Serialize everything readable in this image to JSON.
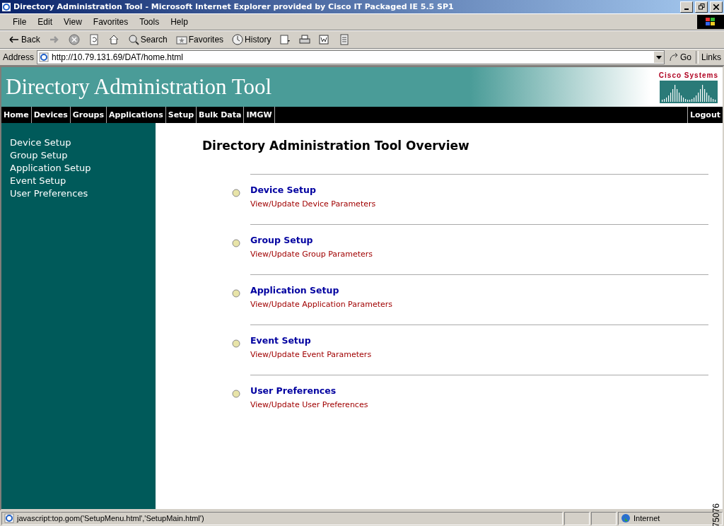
{
  "window": {
    "title": "Directory Administration Tool - Microsoft Internet Explorer provided by Cisco IT Packaged IE 5.5 SP1"
  },
  "menu": [
    "File",
    "Edit",
    "View",
    "Favorites",
    "Tools",
    "Help"
  ],
  "toolbar": [
    {
      "kind": "back",
      "label": "Back"
    },
    {
      "kind": "forward"
    },
    {
      "kind": "stop"
    },
    {
      "kind": "refresh"
    },
    {
      "kind": "home"
    },
    {
      "kind": "search",
      "label": "Search"
    },
    {
      "kind": "favorites",
      "label": "Favorites"
    },
    {
      "kind": "history",
      "label": "History"
    },
    {
      "kind": "mail"
    },
    {
      "kind": "print"
    },
    {
      "kind": "edit"
    },
    {
      "kind": "discuss"
    }
  ],
  "address": {
    "label": "Address",
    "value": "http://10.79.131.69/DAT/home.html",
    "go": "Go",
    "links": "Links"
  },
  "header": {
    "title": "Directory Administration Tool",
    "logo": "Cisco Systems"
  },
  "nav": [
    {
      "label": "Home"
    },
    {
      "label": "Devices"
    },
    {
      "label": "Groups"
    },
    {
      "label": "Applications"
    },
    {
      "label": "Setup"
    },
    {
      "label": "Bulk Data"
    },
    {
      "label": "IMGW"
    }
  ],
  "logout": "Logout",
  "sidebar": {
    "items": [
      "Device Setup",
      "Group Setup",
      "Application Setup",
      "Event Setup",
      "User Preferences"
    ]
  },
  "main": {
    "title": "Directory Administration Tool Overview",
    "entries": [
      {
        "title": "Device Setup",
        "subtitle": "View/Update Device Parameters"
      },
      {
        "title": "Group Setup",
        "subtitle": "View/Update Group Parameters"
      },
      {
        "title": "Application Setup",
        "subtitle": "View/Update Application Parameters"
      },
      {
        "title": "Event Setup",
        "subtitle": "View/Update Event Parameters"
      },
      {
        "title": "User Preferences",
        "subtitle": "View/Update User Preferences"
      }
    ]
  },
  "figure_number": "75076",
  "status_bar": {
    "text": "javascript:top.gom('SetupMenu.html','SetupMain.html')",
    "zone": "Internet"
  }
}
